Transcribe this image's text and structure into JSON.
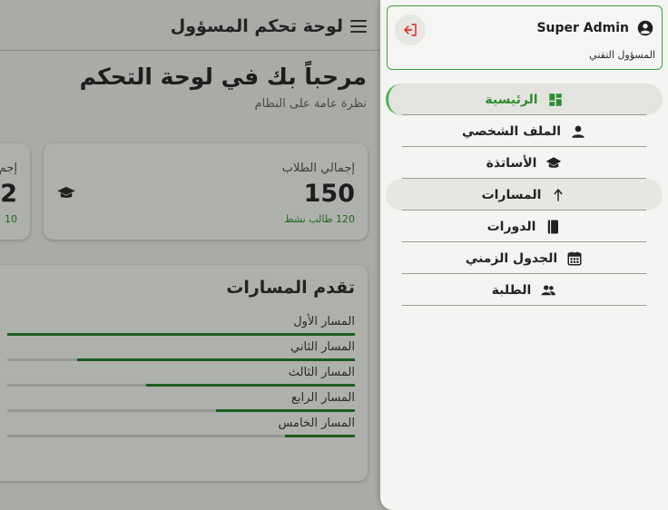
{
  "header": {
    "title": "لوحة تحكم المسؤول"
  },
  "welcome": {
    "title": "مرحباً بك في لوحة التحكم",
    "subtitle": "نظرة عامة على النظام"
  },
  "stats": {
    "students": {
      "label": "إجمالي الطلاب",
      "value": "150",
      "sub": "120 طالب نشط"
    },
    "second": {
      "label": "إجم",
      "value": "2",
      "sub": "10 "
    }
  },
  "progress": {
    "title": "تقدم المسارات",
    "tracks": [
      {
        "label": "المسار الأول",
        "percent": 100
      },
      {
        "label": "المسار الثاني",
        "percent": 80
      },
      {
        "label": "المسار الثالث",
        "percent": 60
      },
      {
        "label": "المسار الرابع",
        "percent": 40
      },
      {
        "label": "المسار الخامس",
        "percent": 20
      }
    ]
  },
  "user": {
    "name": "Super Admin",
    "role": "المسؤول التقني"
  },
  "nav": {
    "items": [
      {
        "label": "الرئيسية",
        "icon": "dashboard-icon",
        "active": true
      },
      {
        "label": "الملف الشخصي",
        "icon": "person-icon"
      },
      {
        "label": "الأساتذة",
        "icon": "graduation-cap-icon"
      },
      {
        "label": "المسارات",
        "icon": "arrow-up-icon",
        "hovered": true
      },
      {
        "label": "الدورات",
        "icon": "book-icon"
      },
      {
        "label": "الجدول الزمني",
        "icon": "calendar-icon"
      },
      {
        "label": "الطلبة",
        "icon": "group-icon"
      }
    ]
  },
  "colors": {
    "accent": "#2f8c2f",
    "logout": "#e53935",
    "progress": "#1d5c1d"
  }
}
